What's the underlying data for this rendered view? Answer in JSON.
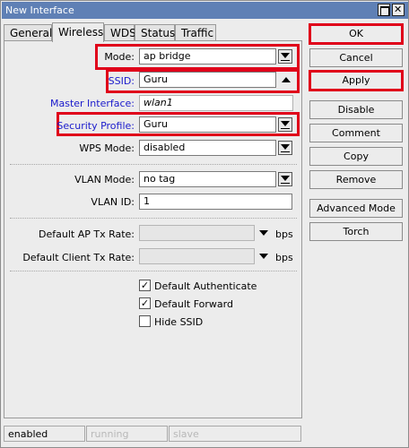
{
  "window": {
    "title": "New Interface"
  },
  "tabs": [
    {
      "label": "General"
    },
    {
      "label": "Wireless"
    },
    {
      "label": "WDS"
    },
    {
      "label": "Status"
    },
    {
      "label": "Traffic"
    }
  ],
  "active_tab": "Wireless",
  "form": {
    "mode": {
      "label": "Mode:",
      "value": "ap bridge"
    },
    "ssid": {
      "label": "SSID:",
      "value": "Guru"
    },
    "master_interface": {
      "label": "Master Interface:",
      "value": "wlan1"
    },
    "security_profile": {
      "label": "Security Profile:",
      "value": "Guru"
    },
    "wps_mode": {
      "label": "WPS Mode:",
      "value": "disabled"
    },
    "vlan_mode": {
      "label": "VLAN Mode:",
      "value": "no tag"
    },
    "vlan_id": {
      "label": "VLAN ID:",
      "value": "1"
    },
    "default_ap_tx_rate": {
      "label": "Default AP Tx Rate:",
      "value": "",
      "unit": "bps"
    },
    "default_client_tx_rate": {
      "label": "Default Client Tx Rate:",
      "value": "",
      "unit": "bps"
    },
    "checkboxes": [
      {
        "label": "Default Authenticate",
        "checked": true
      },
      {
        "label": "Default Forward",
        "checked": true
      },
      {
        "label": "Hide SSID",
        "checked": false
      }
    ]
  },
  "buttons": {
    "ok": "OK",
    "cancel": "Cancel",
    "apply": "Apply",
    "disable": "Disable",
    "comment": "Comment",
    "copy": "Copy",
    "remove": "Remove",
    "advanced_mode": "Advanced Mode",
    "torch": "Torch"
  },
  "status": {
    "state": "enabled",
    "running": "running",
    "slave": "slave"
  },
  "colors": {
    "titlebar": "#5f80b5",
    "highlight": "#e0001a",
    "blue_label": "#1a1acc"
  },
  "icons": {
    "maximize": "maximize-icon",
    "close": "close-icon",
    "dropdown": "triangle-down-icon",
    "collapse": "triangle-up-icon",
    "check": "checkmark-icon"
  }
}
